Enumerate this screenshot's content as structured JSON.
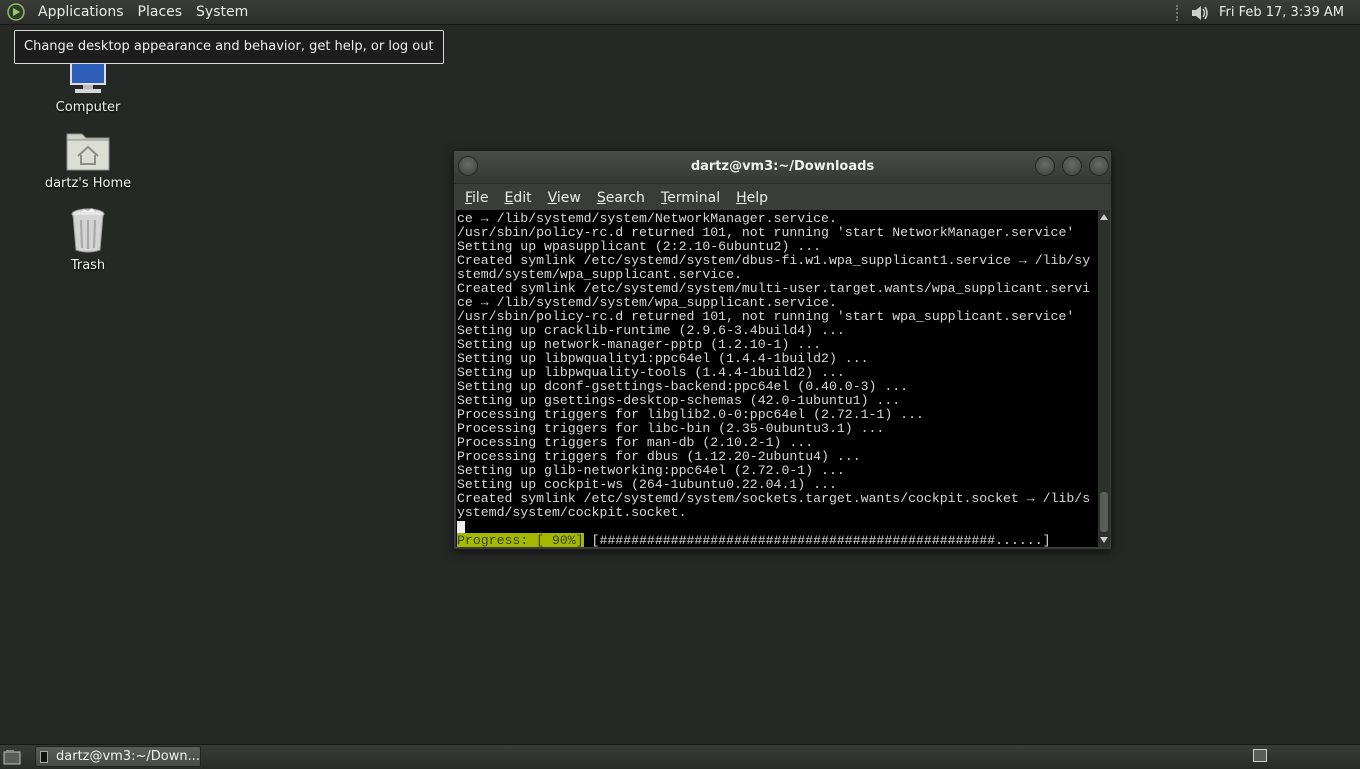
{
  "top_panel": {
    "menus": [
      "Applications",
      "Places",
      "System"
    ],
    "clock": "Fri Feb 17,  3:39 AM"
  },
  "tooltip": "Change desktop appearance and behavior, get help, or log out",
  "desktop_icons": {
    "computer": "Computer",
    "home": "dartz's Home",
    "trash": "Trash"
  },
  "terminal": {
    "title": "dartz@vm3:~/Downloads",
    "menu": [
      {
        "u": "F",
        "rest": "ile"
      },
      {
        "u": "E",
        "rest": "dit"
      },
      {
        "u": "V",
        "rest": "iew"
      },
      {
        "u": "S",
        "rest": "earch"
      },
      {
        "u": "T",
        "rest": "erminal"
      },
      {
        "u": "H",
        "rest": "elp"
      }
    ],
    "lines": [
      "ce → /lib/systemd/system/NetworkManager.service.",
      "/usr/sbin/policy-rc.d returned 101, not running 'start NetworkManager.service'",
      "Setting up wpasupplicant (2:2.10-6ubuntu2) ...",
      "Created symlink /etc/systemd/system/dbus-fi.w1.wpa_supplicant1.service → /lib/sy",
      "stemd/system/wpa_supplicant.service.",
      "Created symlink /etc/systemd/system/multi-user.target.wants/wpa_supplicant.servi",
      "ce → /lib/systemd/system/wpa_supplicant.service.",
      "/usr/sbin/policy-rc.d returned 101, not running 'start wpa_supplicant.service'",
      "Setting up cracklib-runtime (2.9.6-3.4build4) ...",
      "Setting up network-manager-pptp (1.2.10-1) ...",
      "Setting up libpwquality1:ppc64el (1.4.4-1build2) ...",
      "Setting up libpwquality-tools (1.4.4-1build2) ...",
      "Setting up dconf-gsettings-backend:ppc64el (0.40.0-3) ...",
      "Setting up gsettings-desktop-schemas (42.0-1ubuntu1) ...",
      "Processing triggers for libglib2.0-0:ppc64el (2.72.1-1) ...",
      "Processing triggers for libc-bin (2.35-0ubuntu3.1) ...",
      "Processing triggers for man-db (2.10.2-1) ...",
      "Processing triggers for dbus (1.12.20-2ubuntu4) ...",
      "Setting up glib-networking:ppc64el (2.72.0-1) ...",
      "Setting up cockpit-ws (264-1ubuntu0.22.04.1) ...",
      "Created symlink /etc/systemd/system/sockets.target.wants/cockpit.socket → /lib/s",
      "ystemd/system/cockpit.socket."
    ],
    "progress_label": "Progress: [ 90%]",
    "progress_bar": " [##################################################......]",
    "progress": 0.9
  },
  "taskbar": {
    "task_label": "dartz@vm3:~/Down..."
  }
}
